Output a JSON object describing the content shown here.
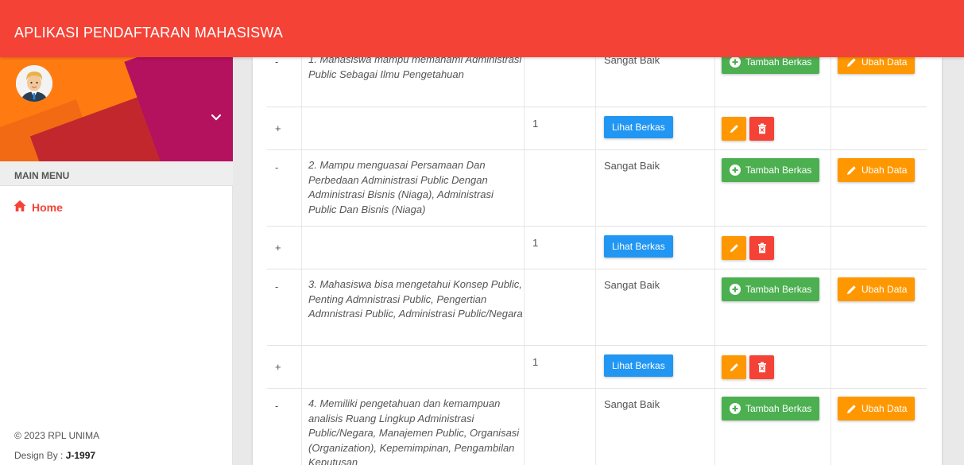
{
  "app": {
    "title": "APLIKASI PENDAFTARAN MAHASISWA"
  },
  "sidebar": {
    "menu_header": "MAIN MENU",
    "items": [
      {
        "label": "Home",
        "icon": "home-icon",
        "active": true
      }
    ],
    "footer": {
      "copyright": "© 2023 RPL UNIMA",
      "design_by_label": "Design By :",
      "design_by_value": "J-1997"
    }
  },
  "colors": {
    "topbar": "#f44336",
    "green": "#4caf50",
    "orange": "#ff9800",
    "blue": "#2196f3",
    "red": "#f44336"
  },
  "table": {
    "rows": [
      {
        "toggle": "-",
        "description": "1. Mahasiswa mampu memahami Administrasi Public Sebagai Ilmu Pengetahuan",
        "rating": "Sangat Baik",
        "add_label": "Tambah Berkas",
        "edit_label": "Ubah Data"
      },
      {
        "toggle": "+",
        "count": "1",
        "view_label": "Lihat Berkas"
      },
      {
        "toggle": "-",
        "description": "2. Mampu menguasai Persamaan Dan Perbedaan Administrasi Public Dengan Administrasi Bisnis (Niaga), Administrasi Public Dan Bisnis (Niaga)",
        "rating": "Sangat Baik",
        "add_label": "Tambah Berkas",
        "edit_label": "Ubah Data"
      },
      {
        "toggle": "+",
        "count": "1",
        "view_label": "Lihat Berkas"
      },
      {
        "toggle": "-",
        "description": "3. Mahasiswa bisa mengetahui Konsep Public, Penting Admnistrasi Public, Pengertian Admnistrasi Public, Administrasi Public/Negara",
        "rating": "Sangat Baik",
        "add_label": "Tambah Berkas",
        "edit_label": "Ubah Data"
      },
      {
        "toggle": "+",
        "count": "1",
        "view_label": "Lihat Berkas"
      },
      {
        "toggle": "-",
        "description": "4. Memiliki pengetahuan dan kemampuan analisis Ruang Lingkup Administrasi Public/Negara, Manajemen Public, Organisasi (Organization), Kepemimpinan, Pengambilan Keputusan",
        "rating": "Sangat Baik",
        "add_label": "Tambah Berkas",
        "edit_label": "Ubah Data"
      }
    ]
  }
}
